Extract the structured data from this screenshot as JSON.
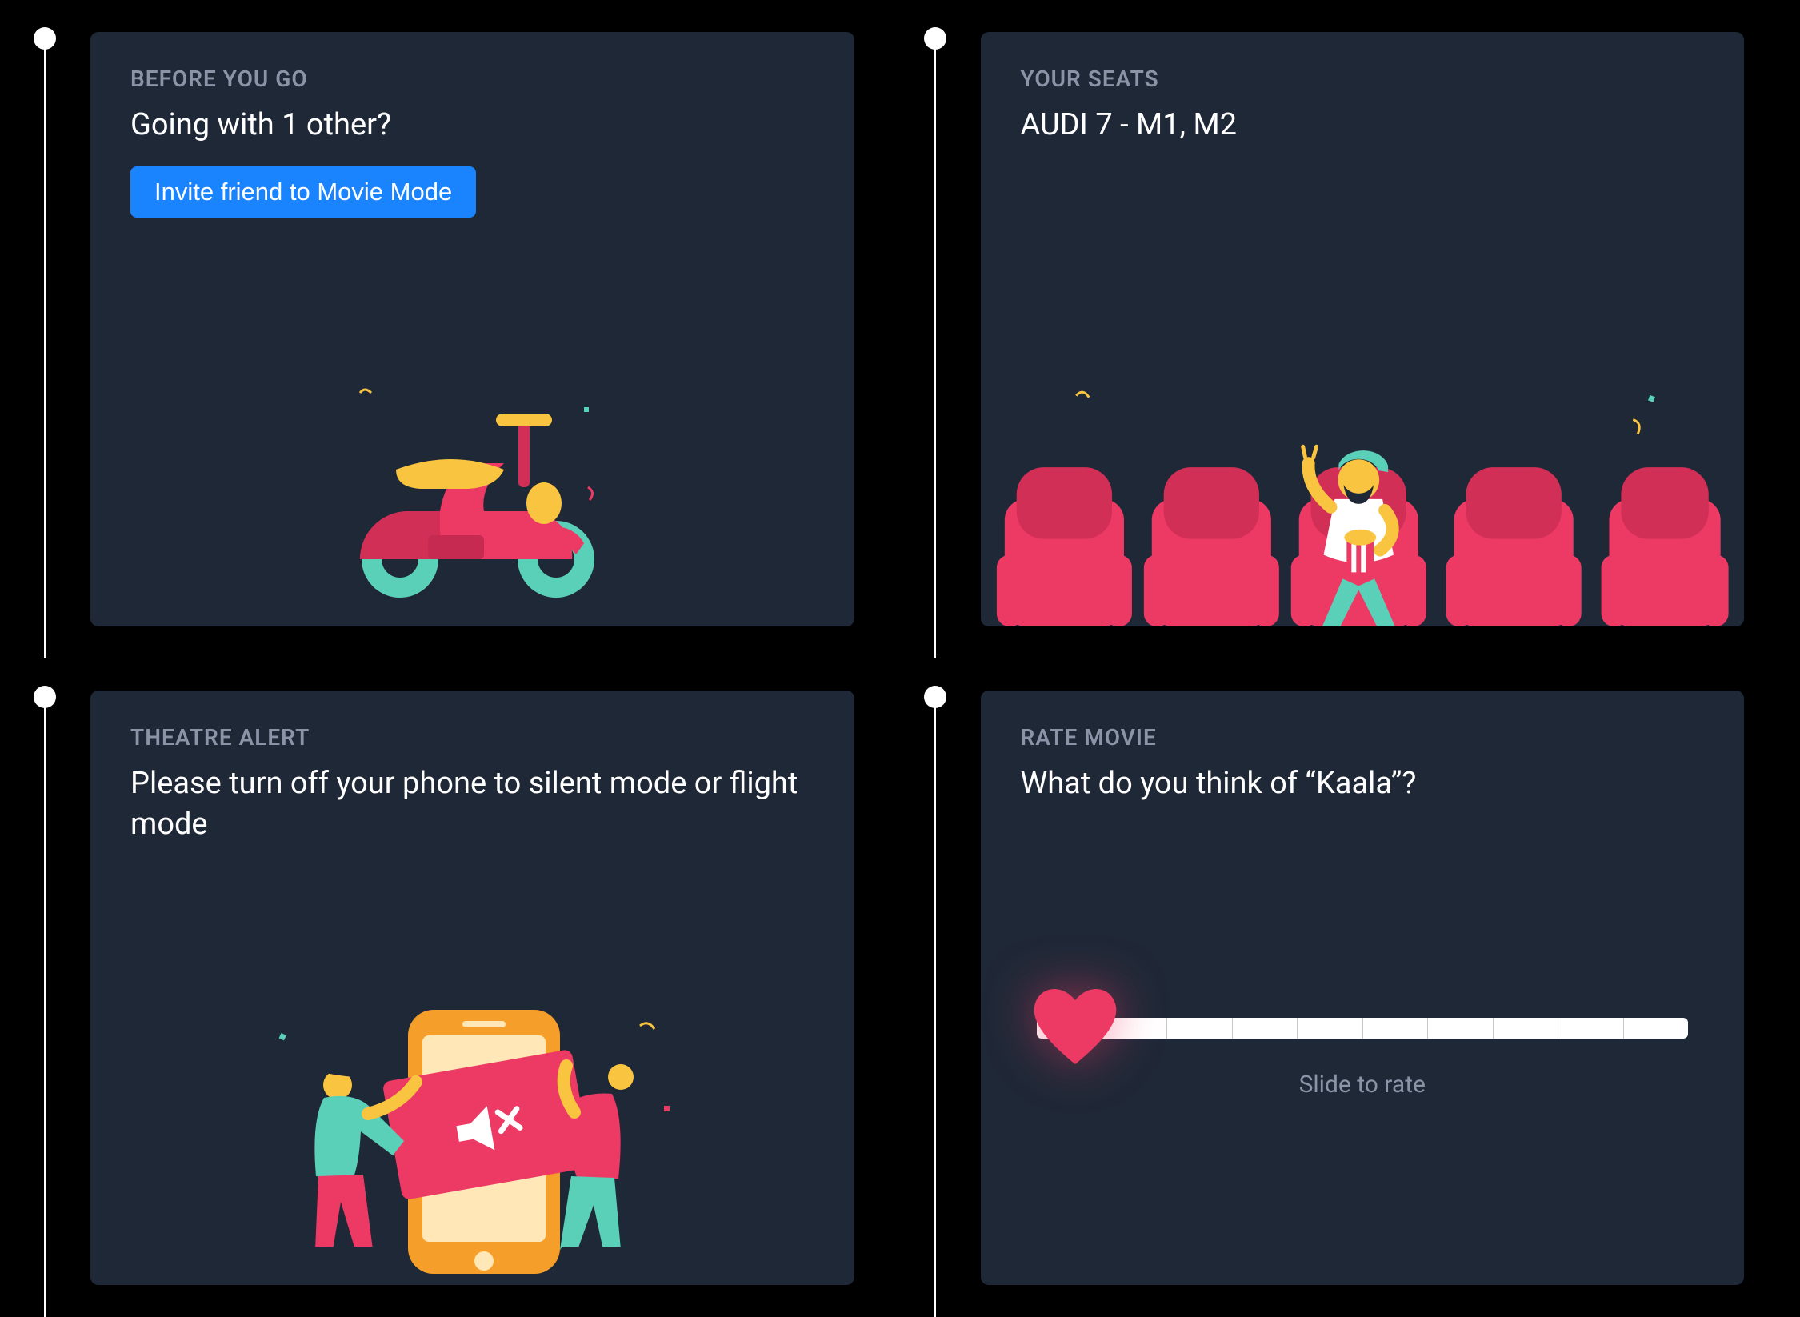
{
  "cards": {
    "before": {
      "eyebrow": "BEFORE YOU GO",
      "title": "Going with 1 other?",
      "button": "Invite friend to Movie Mode"
    },
    "seats": {
      "eyebrow": "YOUR SEATS",
      "title": "AUDI 7 -  M1, M2"
    },
    "alert": {
      "eyebrow": "THEATRE ALERT",
      "title": "Please turn off your phone to silent mode or flight mode"
    },
    "rate": {
      "eyebrow": "RATE MOVIE",
      "title": "What do you think of “Kaala”?",
      "slider_caption": "Slide to rate"
    }
  },
  "colors": {
    "pink": "#ec3a65",
    "teal": "#5bd0b8",
    "yellow": "#f9c440",
    "orange": "#f59f2a",
    "blue": "#1a84ff"
  }
}
